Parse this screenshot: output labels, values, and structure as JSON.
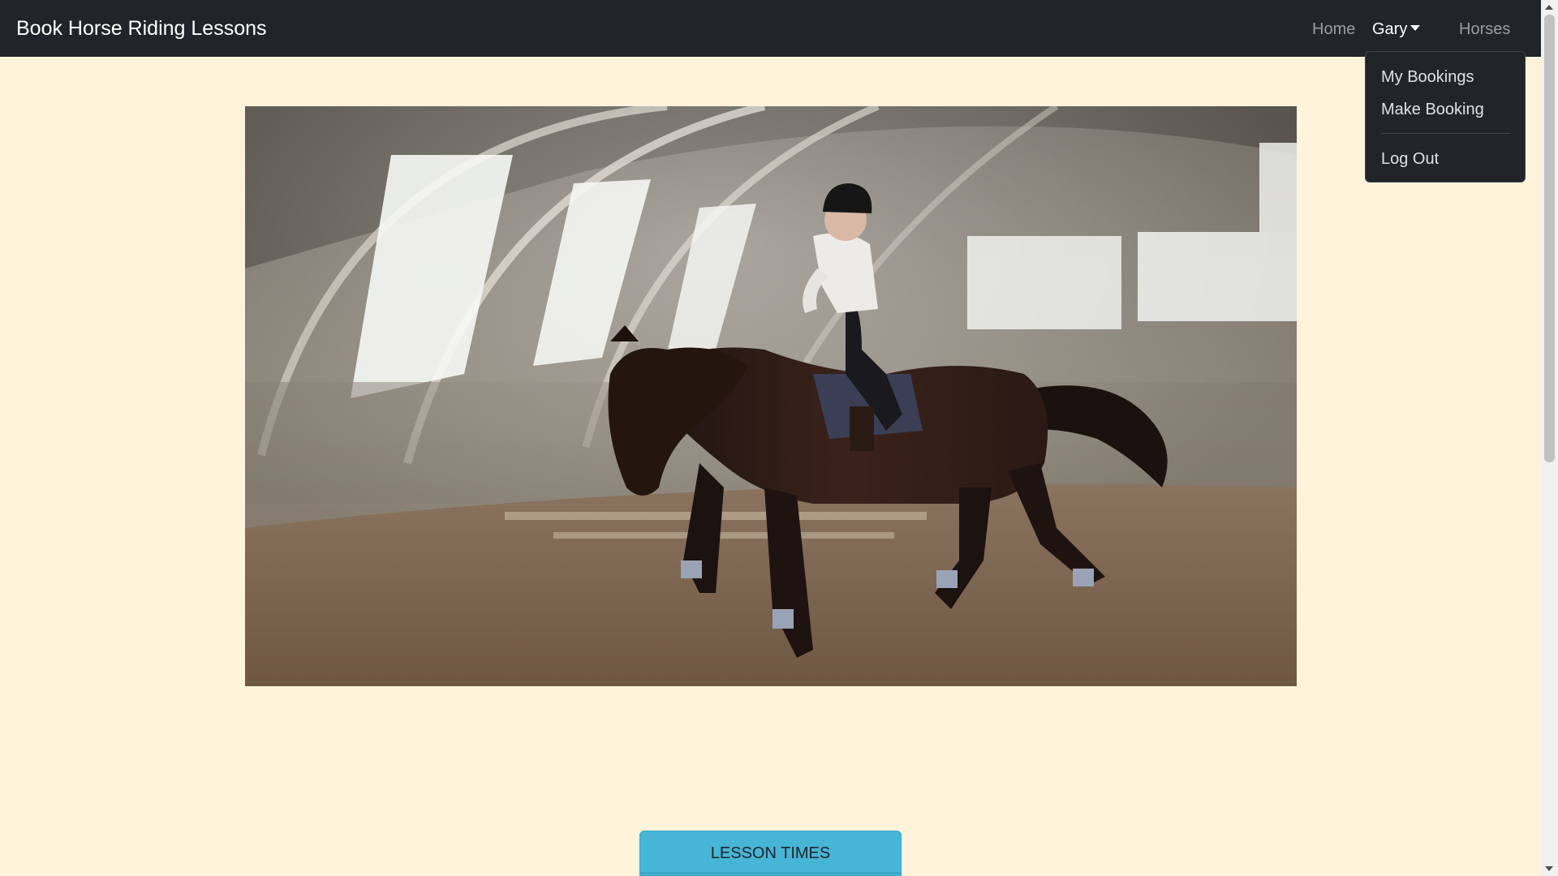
{
  "navbar": {
    "brand": "Book Horse Riding Lessons",
    "links": {
      "home": "Home",
      "user": "Gary",
      "horses": "Horses"
    }
  },
  "user_menu": {
    "items": [
      "My Bookings",
      "Make Booking",
      "Log Out"
    ]
  },
  "hero": {
    "alt": "Rider on a dark bay horse cantering in an indoor arena"
  },
  "lessons": {
    "button_label": "LESSON TIMES"
  },
  "colors": {
    "navbar_bg": "#212529",
    "page_bg": "#fff3dc",
    "accent": "#47b5d6"
  }
}
